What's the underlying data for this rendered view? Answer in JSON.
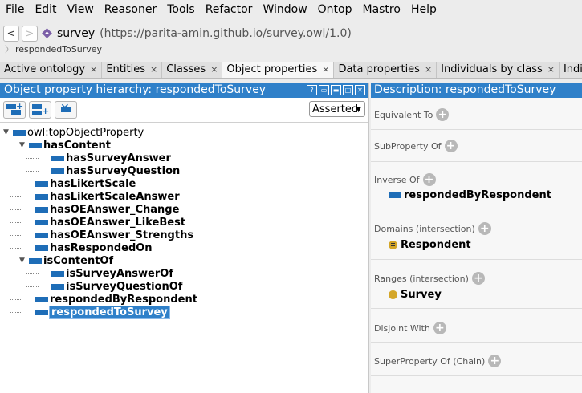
{
  "menu": [
    "File",
    "Edit",
    "View",
    "Reasoner",
    "Tools",
    "Refactor",
    "Window",
    "Ontop",
    "Mastro",
    "Help"
  ],
  "address": {
    "back": "<",
    "forward": ">",
    "name": "survey",
    "uri": "(https://parita-amin.github.io/survey.owl/1.0)"
  },
  "breadcrumb": "respondedToSurvey",
  "tabs": [
    {
      "label": "Active ontology",
      "close": "×"
    },
    {
      "label": "Entities",
      "close": "×"
    },
    {
      "label": "Classes",
      "close": "×"
    },
    {
      "label": "Object properties",
      "close": "×"
    },
    {
      "label": "Data properties",
      "close": "×"
    },
    {
      "label": "Individuals by class",
      "close": "×"
    },
    {
      "label": "Individual Hi",
      "close": ""
    }
  ],
  "hierarchy": {
    "title": "Object property hierarchy: respondedToSurvey",
    "view_mode": "Asserted",
    "nodes": [
      {
        "label": "owl:topObjectProperty"
      },
      {
        "label": "hasContent"
      },
      {
        "label": "hasSurveyAnswer"
      },
      {
        "label": "hasSurveyQuestion"
      },
      {
        "label": "hasLikertScale"
      },
      {
        "label": "hasLikertScaleAnswer"
      },
      {
        "label": "hasOEAnswer_Change"
      },
      {
        "label": "hasOEAnswer_LikeBest"
      },
      {
        "label": "hasOEAnswer_Strengths"
      },
      {
        "label": "hasRespondedOn"
      },
      {
        "label": "isContentOf"
      },
      {
        "label": "isSurveyAnswerOf"
      },
      {
        "label": "isSurveyQuestionOf"
      },
      {
        "label": "respondedByRespondent"
      },
      {
        "label": "respondedToSurvey"
      }
    ]
  },
  "description": {
    "title": "Description: respondedToSurvey",
    "sections": [
      {
        "label": "Equivalent To"
      },
      {
        "label": "SubProperty Of"
      },
      {
        "label": "Inverse Of",
        "value": "respondedByRespondent"
      },
      {
        "label": "Domains (intersection)",
        "value": "Respondent"
      },
      {
        "label": "Ranges (intersection)",
        "value": "Survey"
      },
      {
        "label": "Disjoint With"
      },
      {
        "label": "SuperProperty Of (Chain)"
      }
    ]
  }
}
